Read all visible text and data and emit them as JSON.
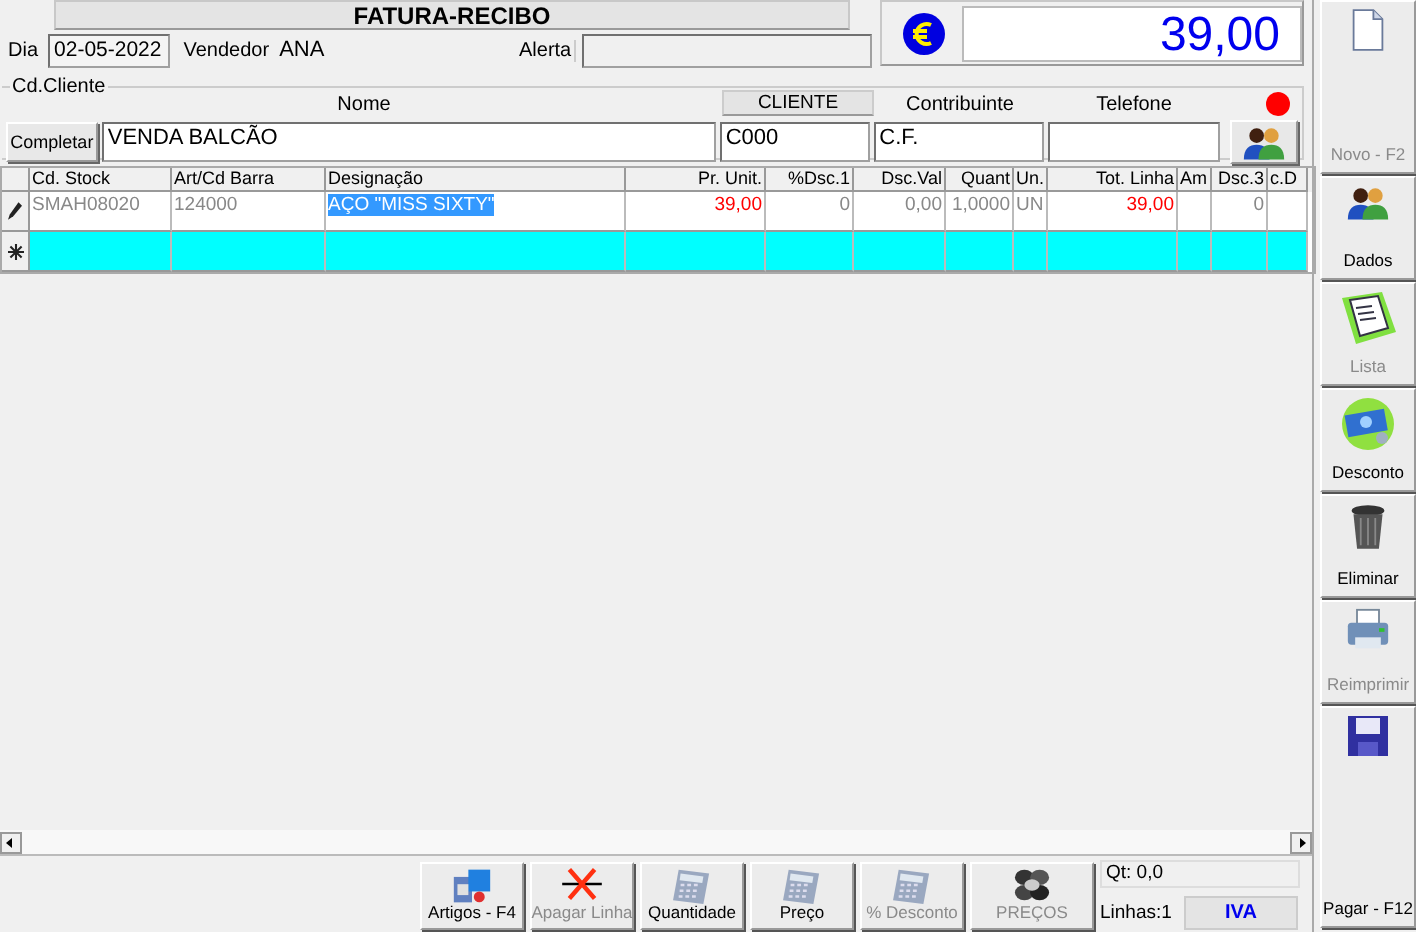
{
  "header": {
    "title": "FATURA-RECIBO",
    "dia_label": "Dia",
    "dia": "02-05-2022",
    "vendedor_label": "Vendedor",
    "vendedor": "ANA",
    "alerta_label": "Alerta"
  },
  "total": "39,00",
  "cliente": {
    "group_label": "Cd.Cliente",
    "nome_label": "Nome",
    "cliente_label": "CLIENTE",
    "contribuinte_label": "Contribuinte",
    "telefone_label": "Telefone",
    "completar_button": "Completar",
    "nome": "VENDA BALCÃO",
    "codigo": "C000",
    "contribuinte": "C.F."
  },
  "grid": {
    "columns": [
      {
        "label": "Cd. Stock",
        "kind": "text"
      },
      {
        "label": "Art/Cd Barra",
        "kind": "text"
      },
      {
        "label": "Designação",
        "kind": "text"
      },
      {
        "label": "Pr. Unit.",
        "kind": "money"
      },
      {
        "label": "%Dsc.1",
        "kind": "number"
      },
      {
        "label": "Dsc.Val",
        "kind": "number"
      },
      {
        "label": "Quant",
        "kind": "number"
      },
      {
        "label": "Un.",
        "kind": "text"
      },
      {
        "label": "Tot. Linha",
        "kind": "money"
      },
      {
        "label": "Am",
        "kind": "text"
      },
      {
        "label": "Dsc.3",
        "kind": "number"
      },
      {
        "label": "c.D",
        "kind": "text"
      }
    ],
    "rows": [
      {
        "kind": "edit",
        "cells": [
          {
            "text": "SMAH08020",
            "selected": false
          },
          {
            "text": "124000",
            "selected": false
          },
          {
            "text": "AÇO \"MISS SIXTY\"",
            "selected": true
          },
          {
            "text": "39,00",
            "selected": false
          },
          {
            "text": "0",
            "selected": false
          },
          {
            "text": "0,00",
            "selected": false
          },
          {
            "text": "1,0000",
            "selected": false
          },
          {
            "text": "UN",
            "selected": false
          },
          {
            "text": "39,00",
            "selected": false
          },
          {
            "selected": false
          },
          {
            "text": "0",
            "selected": false
          },
          {
            "selected": false
          }
        ]
      },
      {
        "kind": "new",
        "cells": [
          {
            "selected": false
          },
          {
            "selected": false
          },
          {
            "selected": false
          },
          {
            "selected": false
          },
          {
            "selected": false
          },
          {
            "selected": false
          },
          {
            "selected": false
          },
          {
            "selected": false
          },
          {
            "selected": false
          },
          {
            "selected": false
          },
          {
            "selected": false
          },
          {
            "selected": false
          }
        ]
      }
    ]
  },
  "bottom_buttons": [
    {
      "label": "Artigos - F4",
      "disabled": false
    },
    {
      "label": "Apagar Linha",
      "disabled": true
    },
    {
      "label": "Quantidade",
      "disabled": false
    },
    {
      "label": "Preço",
      "disabled": false
    },
    {
      "label": "% Desconto",
      "disabled": true
    },
    {
      "label": "PREÇOS",
      "disabled": true
    }
  ],
  "status": {
    "qt": "Qt: 0,0",
    "linhas": "Linhas:1",
    "iva": "IVA"
  },
  "sidebar": [
    {
      "label": "Novo - F2",
      "disabled": true
    },
    {
      "label": "Dados",
      "disabled": false
    },
    {
      "label": "Lista",
      "disabled": true
    },
    {
      "label": "Desconto",
      "disabled": false
    },
    {
      "label": "Eliminar",
      "disabled": false
    },
    {
      "label": "Reimprimir",
      "disabled": true
    },
    {
      "label": "Pagar - F12",
      "disabled": false
    }
  ]
}
